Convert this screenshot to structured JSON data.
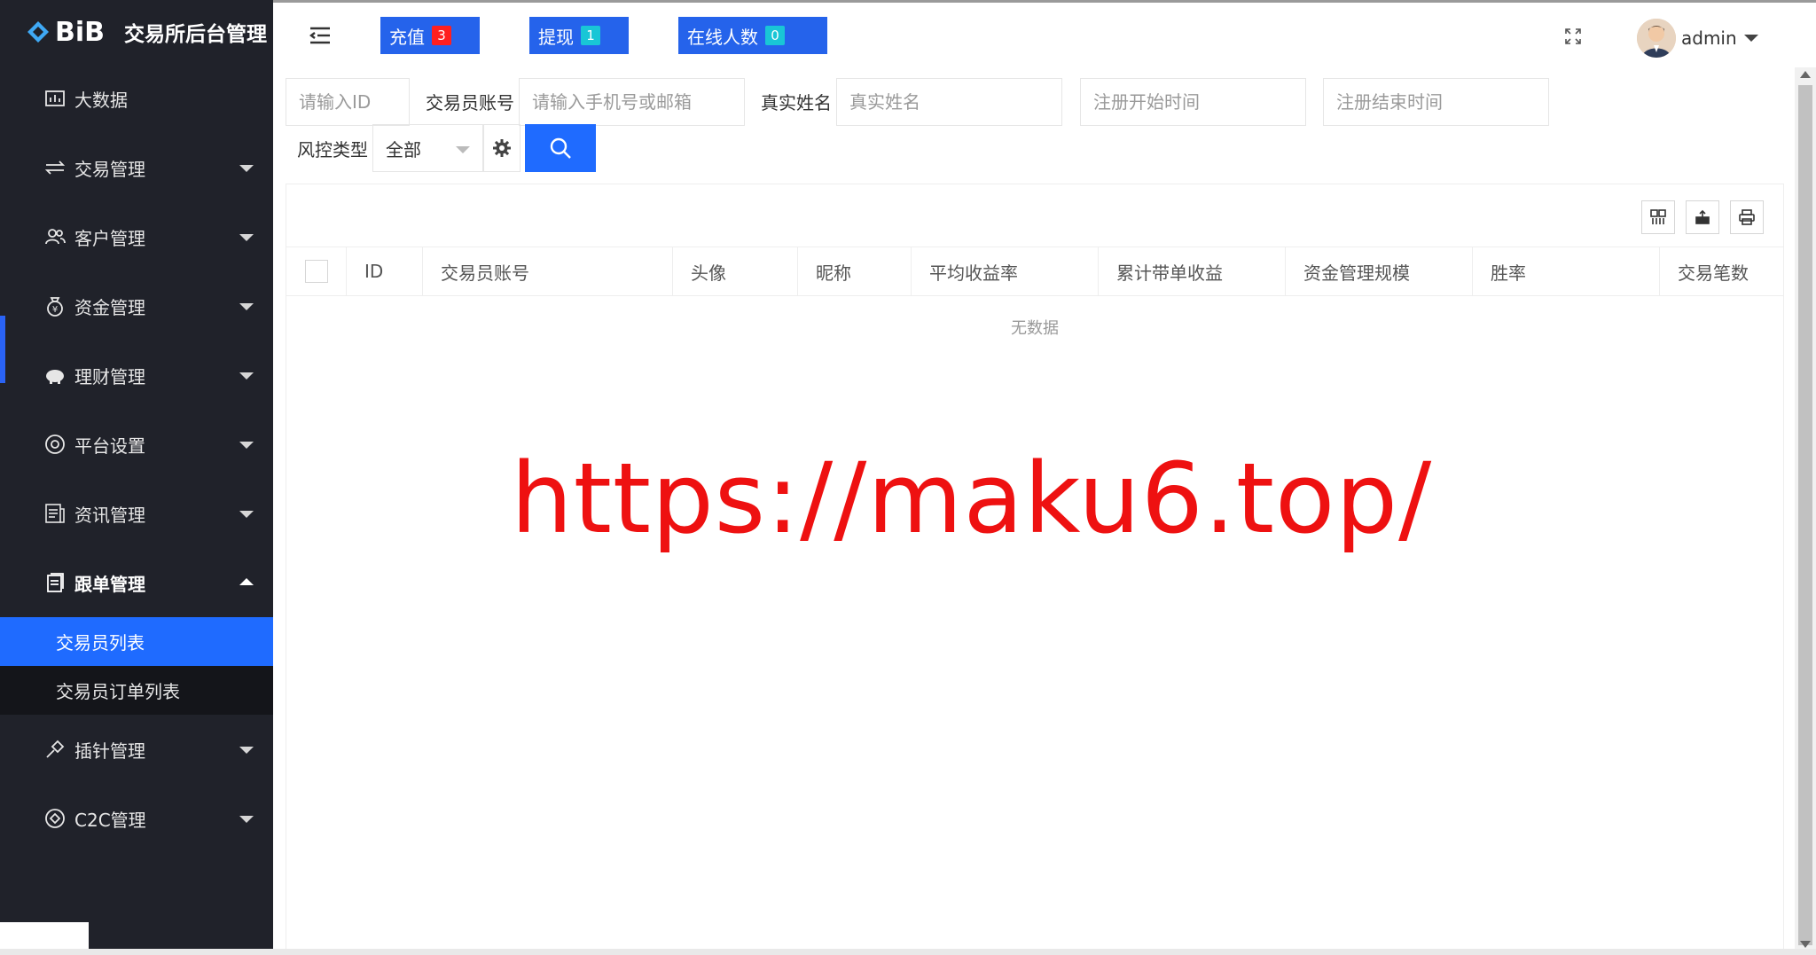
{
  "brand": {
    "logo_text": "BiB",
    "title": "交易所后台管理"
  },
  "sidebar": {
    "items": [
      {
        "label": "大数据",
        "icon": "chart-icon"
      },
      {
        "label": "交易管理",
        "icon": "exchange-icon"
      },
      {
        "label": "客户管理",
        "icon": "users-icon"
      },
      {
        "label": "资金管理",
        "icon": "money-bag-icon"
      },
      {
        "label": "理财管理",
        "icon": "piggy-bank-icon"
      },
      {
        "label": "平台设置",
        "icon": "settings-icon"
      },
      {
        "label": "资讯管理",
        "icon": "news-icon"
      },
      {
        "label": "跟单管理",
        "icon": "document-icon"
      },
      {
        "label": "插针管理",
        "icon": "pin-icon"
      },
      {
        "label": "C2C管理",
        "icon": "c2c-icon"
      }
    ],
    "submenu": [
      {
        "label": "交易员列表",
        "active": true
      },
      {
        "label": "交易员订单列表",
        "active": false
      }
    ]
  },
  "header": {
    "recharge": {
      "label": "充值",
      "count": "3",
      "badge_color": "#ff1f1f"
    },
    "withdraw": {
      "label": "提现",
      "count": "1",
      "badge_color": "#19c6d6"
    },
    "online": {
      "label": "在线人数",
      "count": "0",
      "badge_color": "#19c6d6"
    },
    "username": "admin"
  },
  "filters": {
    "id_placeholder": "请输入ID",
    "account_label": "交易员账号",
    "account_placeholder": "请输入手机号或邮箱",
    "realname_label": "真实姓名",
    "realname_placeholder": "真实姓名",
    "reg_start_placeholder": "注册开始时间",
    "reg_end_placeholder": "注册结束时间",
    "risk_label": "风控类型",
    "risk_value": "全部"
  },
  "table": {
    "columns": [
      "ID",
      "交易员账号",
      "头像",
      "昵称",
      "平均收益率",
      "累计带单收益",
      "资金管理规模",
      "胜率",
      "交易笔数"
    ],
    "empty_text": "无数据"
  },
  "watermark": "https://maku6.top/",
  "colors": {
    "accent": "#1f6bff",
    "sidebar_bg": "#20222a",
    "watermark": "#ee1111"
  }
}
